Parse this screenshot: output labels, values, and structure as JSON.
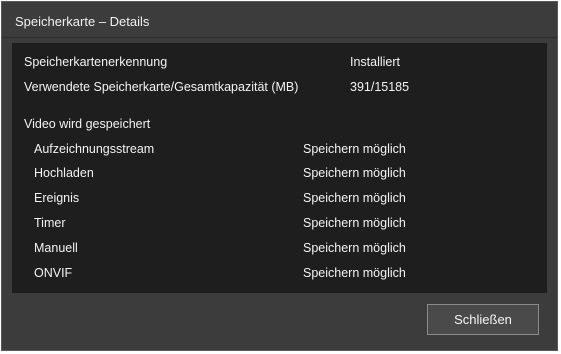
{
  "dialog": {
    "title": "Speicherkarte – Details"
  },
  "status": {
    "recognition_label": "Speicherkartenerkennung",
    "recognition_value": "Installiert",
    "capacity_label": "Verwendete Speicherkarte/Gesamtkapazität (MB)",
    "capacity_value": "391/15185"
  },
  "video_section": {
    "heading": "Video wird gespeichert",
    "items": [
      {
        "label": "Aufzeichnungsstream",
        "value": "Speichern möglich"
      },
      {
        "label": "Hochladen",
        "value": "Speichern möglich"
      },
      {
        "label": "Ereignis",
        "value": "Speichern möglich"
      },
      {
        "label": "Timer",
        "value": "Speichern möglich"
      },
      {
        "label": "Manuell",
        "value": "Speichern möglich"
      },
      {
        "label": "ONVIF",
        "value": "Speichern möglich"
      }
    ]
  },
  "footer": {
    "close_label": "Schließen"
  }
}
